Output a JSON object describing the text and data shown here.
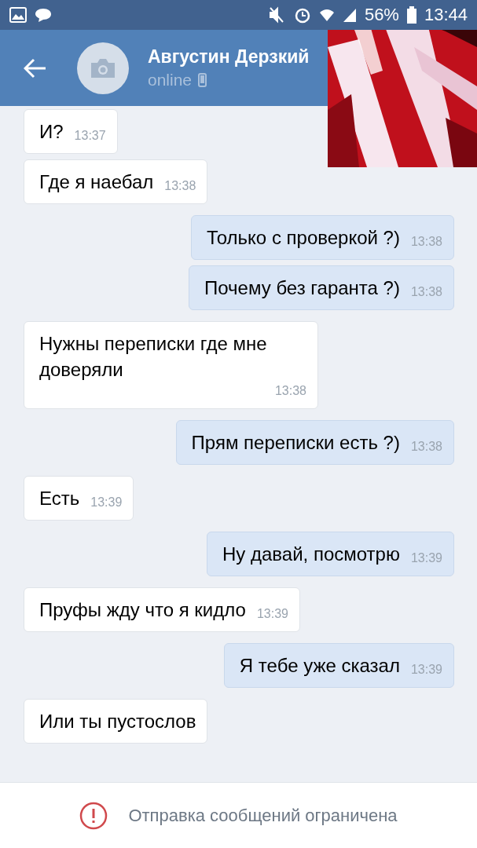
{
  "status_bar": {
    "time": "13:44",
    "battery": "56%"
  },
  "header": {
    "name": "Августин Дерзкий",
    "status": "online"
  },
  "messages": [
    {
      "kind": "received",
      "text": "И?",
      "time": "13:37"
    },
    {
      "kind": "received",
      "text": "Где я наебал",
      "time": "13:38"
    },
    {
      "kind": "sent",
      "text": "Только с проверкой ?)",
      "time": "13:38"
    },
    {
      "kind": "sent",
      "text": "Почему без гаранта ?)",
      "time": "13:38"
    },
    {
      "kind": "received",
      "text": "Нужны переписки где мне доверяли",
      "time": "13:38"
    },
    {
      "kind": "sent",
      "text": "Прям переписки есть ?)",
      "time": "13:38"
    },
    {
      "kind": "received",
      "text": "Есть",
      "time": "13:39"
    },
    {
      "kind": "sent",
      "text": "Ну давай, посмотрю",
      "time": "13:39"
    },
    {
      "kind": "received",
      "text": "Пруфы жду что я кидло",
      "time": "13:39"
    },
    {
      "kind": "sent",
      "text": "Я тебе уже сказал",
      "time": "13:39"
    },
    {
      "kind": "received",
      "text": "Или ты пустослов"
    }
  ],
  "notice": {
    "text": "Отправка сообщений ограничена"
  }
}
